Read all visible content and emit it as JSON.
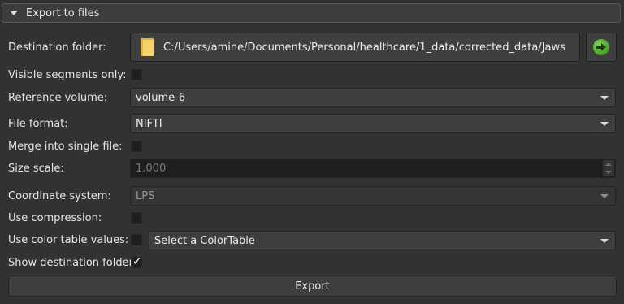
{
  "section": {
    "title": "Export to files"
  },
  "fields": {
    "destination_folder": {
      "label": "Destination folder:",
      "path": "C:/Users/amine/Documents/Personal/healthcare/1_data/corrected_data/Jaws"
    },
    "visible_segments_only": {
      "label": "Visible segments only:",
      "checked": false
    },
    "reference_volume": {
      "label": "Reference volume:",
      "value": "volume-6"
    },
    "file_format": {
      "label": "File format:",
      "value": "NIFTI"
    },
    "merge_into_single_file": {
      "label": "Merge into single file:",
      "checked": false
    },
    "size_scale": {
      "label": "Size scale:",
      "value": "1.000"
    },
    "coordinate_system": {
      "label": "Coordinate system:",
      "value": "LPS"
    },
    "use_compression": {
      "label": "Use compression:",
      "checked": false
    },
    "use_color_table_values": {
      "label": "Use color table values:",
      "checked": false,
      "color_table": "Select a ColorTable"
    },
    "show_destination_folder": {
      "label": "Show destination folder:",
      "checked": true,
      "checkmark": "✓"
    }
  },
  "actions": {
    "export_label": "Export"
  },
  "icons": {
    "section_toggle": "chevron-down-icon",
    "folder": "folder-icon",
    "go": "green-arrow-icon"
  },
  "colors": {
    "background": "#323232",
    "go_green": "#3fa51f",
    "folder_yellow": "#f6d26a"
  }
}
